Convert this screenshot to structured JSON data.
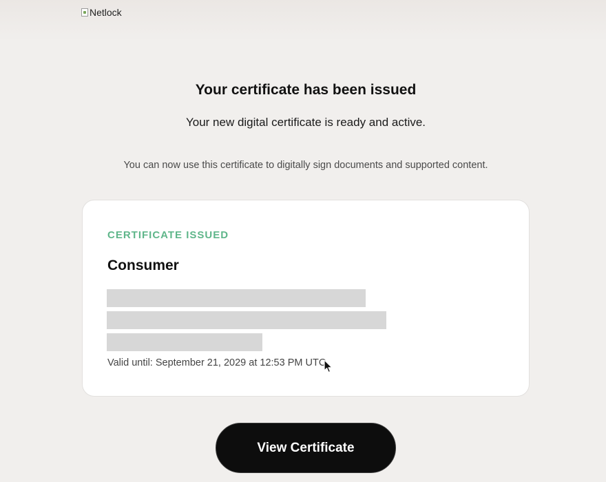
{
  "logo": {
    "alt_text": "Netlock"
  },
  "header": {
    "title": "Your certificate has been issued",
    "subtitle": "Your new digital certificate is ready and active."
  },
  "info_text": "You can now use this certificate to digitally sign documents and supported content.",
  "card": {
    "status_label": "CERTIFICATE ISSUED",
    "certificate_type": "Consumer",
    "valid_until": "Valid until: September 21, 2029 at 12:53 PM UTC"
  },
  "actions": {
    "view_label": "View Certificate"
  },
  "colors": {
    "accent_green": "#5fb68a",
    "button_bg": "#0d0d0d",
    "page_bg": "#f1efed"
  },
  "icons": {
    "logo": "broken-image-icon",
    "pointer": "mouse-cursor-icon"
  }
}
